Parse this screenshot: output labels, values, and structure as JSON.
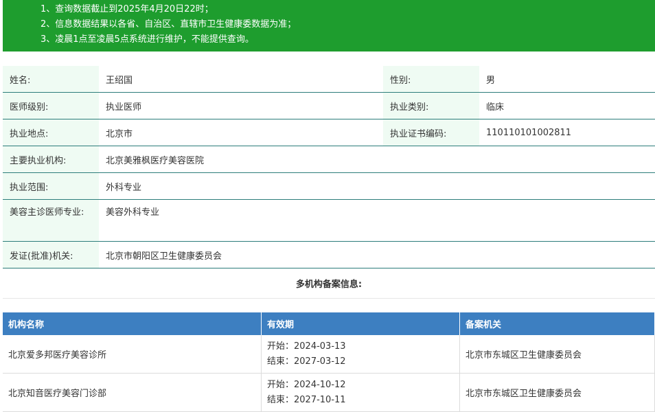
{
  "notice": {
    "line1": "1、查询数据截止到2025年4月20日22时；",
    "line2": "2、信息数据结果以各省、自治区、直辖市卫生健康委数据为准；",
    "line3": "3、凌晨1点至凌晨5点系统进行维护，不能提供查询。"
  },
  "info": {
    "name_label": "姓名:",
    "name": "王绍国",
    "gender_label": "性别:",
    "gender": "男",
    "level_label": "医师级别:",
    "level": "执业医师",
    "category_label": "执业类别:",
    "category": "临床",
    "location_label": "执业地点:",
    "location": "北京市",
    "cert_label": "执业证书编码:",
    "cert": "110110101002811",
    "org_label": "主要执业机构:",
    "org": "北京美雅枫医疗美容医院",
    "scope_label": "执业范围:",
    "scope": "外科专业",
    "beauty_label": "美容主诊医师专业:",
    "beauty": "美容外科专业",
    "issuer_label": "发证(批准)机关:",
    "issuer": "北京市朝阳区卫生健康委员会"
  },
  "multi_title": "多机构备案信息:",
  "registry": {
    "headers": [
      "机构名称",
      "有效期",
      "备案机关"
    ],
    "rows": [
      {
        "org": "北京爱多邦医疗美容诊所",
        "start": "开始：2024-03-13",
        "end": "结束：2027-03-12",
        "authority": "北京市东城区卫生健康委员会"
      },
      {
        "org": "北京知音医疗美容门诊部",
        "start": "开始：2024-10-12",
        "end": "结束：2027-10-11",
        "authority": "北京市东城区卫生健康委员会"
      }
    ]
  },
  "colors": {
    "banner": "#1e9d2e",
    "header": "#3d7fc1",
    "label_bg": "#effbf3",
    "row_border": "#2b7c7a"
  }
}
